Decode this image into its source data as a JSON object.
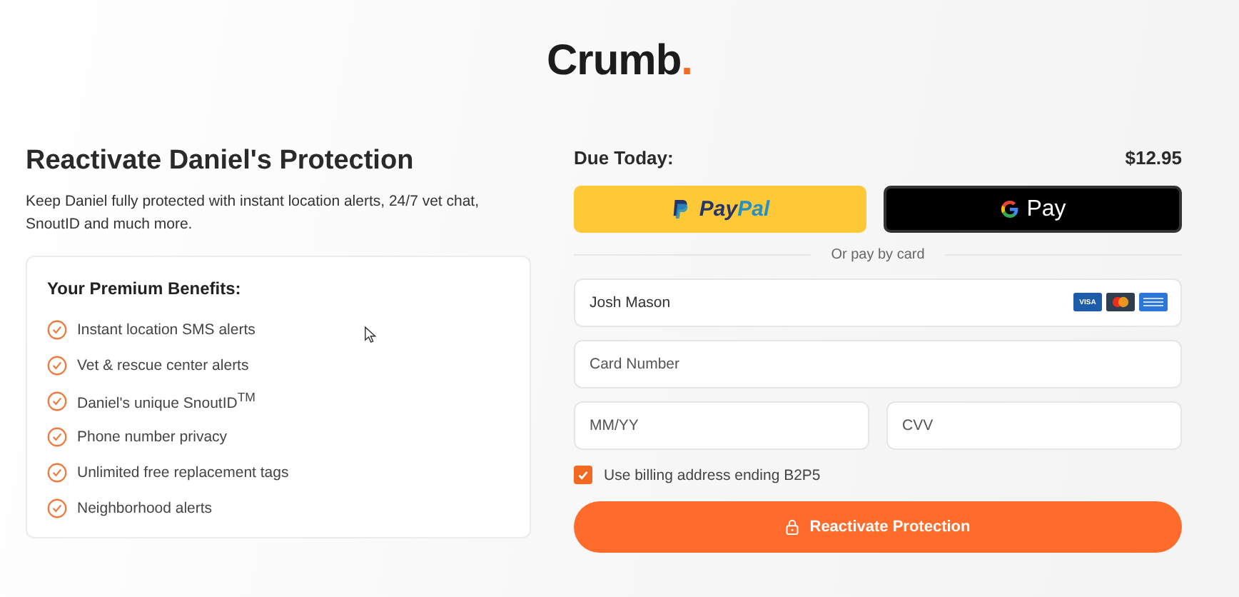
{
  "logo": {
    "name": "Crumb",
    "mark": "."
  },
  "intro": {
    "title": "Reactivate Daniel's Protection",
    "description": "Keep Daniel fully protected with instant location alerts, 24/7 vet chat, SnoutID and much more."
  },
  "benefits": {
    "title": "Your Premium Benefits:",
    "items": [
      {
        "text": "Instant location SMS alerts"
      },
      {
        "text": "Vet & rescue center alerts"
      },
      {
        "text": "Daniel's unique SnoutID$^{TM}$"
      },
      {
        "text": "Phone number privacy"
      },
      {
        "text": "Unlimited free replacement tags"
      },
      {
        "text": "Neighborhood alerts"
      }
    ]
  },
  "payment": {
    "due_label": "Due Today:",
    "amount": "$12.95",
    "wallets": [
      {
        "kind": "paypal",
        "label_dark": "Pay",
        "label_light": "Pal"
      },
      {
        "kind": "gpay",
        "label": "Pay"
      }
    ],
    "divider": "Or pay by card",
    "name_value": "Josh Mason",
    "card_brands": [
      {
        "kind": "visa",
        "label": "VISA"
      },
      {
        "kind": "mastercard"
      },
      {
        "kind": "amex"
      }
    ],
    "card_number_placeholder": "Card Number",
    "expiry_placeholder": "MM/YY",
    "cvv_placeholder": "CVV",
    "billing": {
      "label": "Use billing address ending B2P5",
      "checked": true
    },
    "submit": "Reactivate Protection"
  }
}
